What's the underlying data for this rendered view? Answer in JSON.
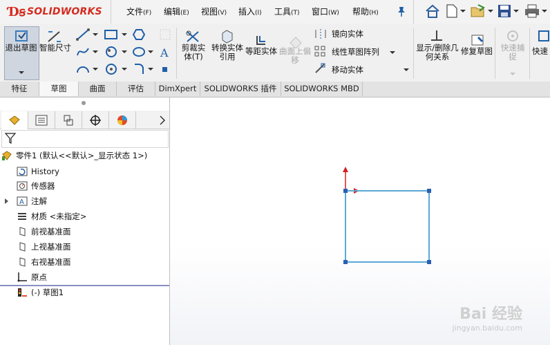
{
  "app": {
    "logo_ds": "Ɗꞩ",
    "logo_text": "SOLIDWORKS"
  },
  "menu": [
    {
      "label": "文件",
      "key": "(F)"
    },
    {
      "label": "编辑",
      "key": "(E)"
    },
    {
      "label": "视图",
      "key": "(V)"
    },
    {
      "label": "插入",
      "key": "(I)"
    },
    {
      "label": "工具",
      "key": "(T)"
    },
    {
      "label": "窗口",
      "key": "(W)"
    },
    {
      "label": "帮助",
      "key": "(H)"
    }
  ],
  "toolbar": {
    "exit_sketch": "退出草图",
    "smart_dim": "智能尺寸",
    "trim": "剪裁实体(T)",
    "convert": "转换实体引用",
    "offset": "等距实体",
    "surface_offset": "曲面上偏移",
    "mirror": "镜向实体",
    "linear_pattern": "线性草图阵列",
    "move": "移动实体",
    "display_relations": "显示/删除几何关系",
    "repair": "修复草图",
    "quick_snap": "快速捕捉",
    "quick": "快速"
  },
  "tabs": [
    "特征",
    "草图",
    "曲面",
    "评估",
    "DimXpert",
    "SOLIDWORKS 插件",
    "SOLIDWORKS MBD"
  ],
  "tree": {
    "part": "零件1 (默认<<默认>_显示状态 1>)",
    "history": "History",
    "sensors": "传感器",
    "annotations": "注解",
    "material": "材质 <未指定>",
    "front_plane": "前视基准面",
    "top_plane": "上视基准面",
    "right_plane": "右视基准面",
    "origin": "原点",
    "sketch": "(-) 草图1"
  },
  "watermark": {
    "line1": "Bai 经验",
    "line2": "jingyan.baidu.com"
  },
  "colors": {
    "brand_red": "#d52b1e",
    "sketch_line": "#5aa9d6",
    "axis_red": "#d42020",
    "point_blue": "#2b5fb3"
  }
}
